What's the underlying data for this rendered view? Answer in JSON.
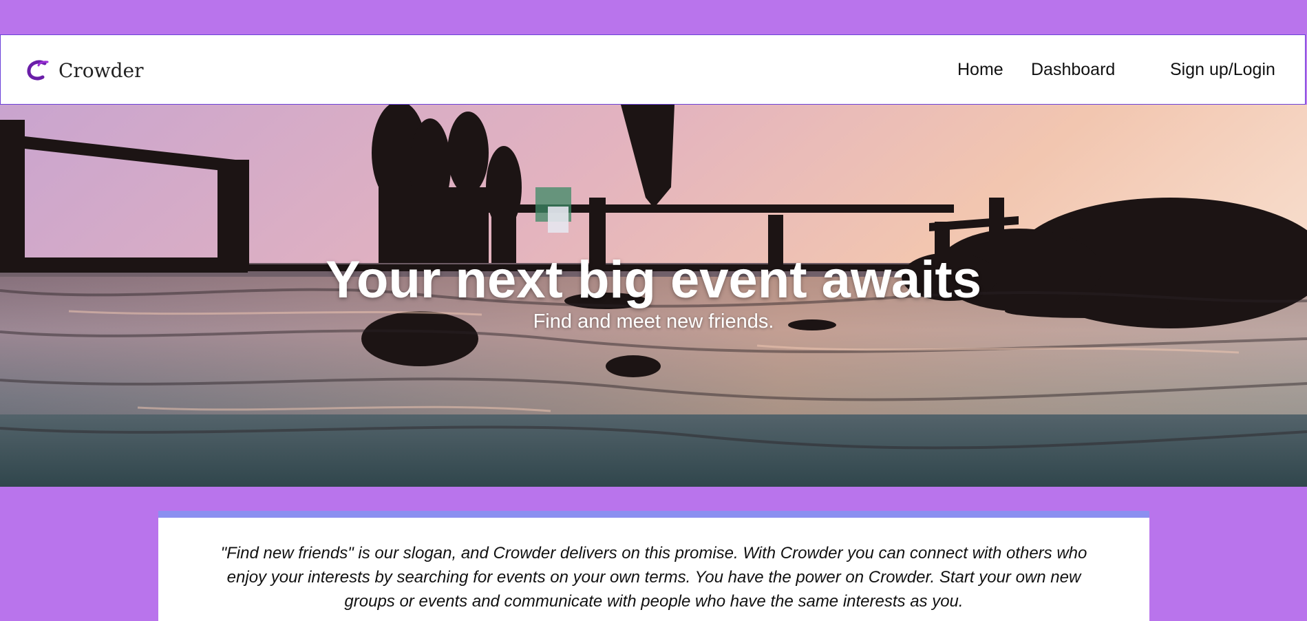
{
  "brand": {
    "name": "Crowder",
    "logo_icon": "crowder-c-logo-icon",
    "logo_colors": [
      "#9b2fd6",
      "#6a1ea8"
    ]
  },
  "nav": {
    "home": "Home",
    "dashboard": "Dashboard",
    "signup": "Sign up/Login"
  },
  "hero": {
    "title": "Your next big event awaits",
    "subtitle": "Find and meet new friends.",
    "image": "sunset-pier-friends-photo"
  },
  "about": {
    "text": "\"Find new friends\" is our slogan, and Crowder delivers on this promise. With Crowder you can connect with others who enjoy your interests by searching for events on your own terms. You have the power on Crowder. Start your own new groups or events and communicate with people who have the same interests as you."
  },
  "colors": {
    "page_background": "#b974ec",
    "navbar_border": "#6a40d8",
    "card_accent": "#8b8ff0"
  }
}
